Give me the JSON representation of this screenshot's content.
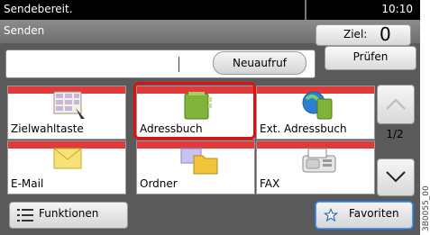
{
  "status": {
    "text": "Sendebereit.",
    "time": "10:10"
  },
  "title": {
    "text": "Senden"
  },
  "destination": {
    "label": "Ziel:",
    "count": "0"
  },
  "actions": {
    "recall": "Neuaufruf",
    "check": "Prüfen"
  },
  "tiles": [
    {
      "label": "Zielwahltaste",
      "icon": "speed-dial-icon"
    },
    {
      "label": "Adressbuch",
      "icon": "address-book-icon",
      "selected": true
    },
    {
      "label": "Ext. Adressbuch",
      "icon": "external-address-book-icon"
    },
    {
      "label": "E-Mail",
      "icon": "email-icon"
    },
    {
      "label": "Ordner",
      "icon": "folder-icon"
    },
    {
      "label": "FAX",
      "icon": "fax-icon"
    }
  ],
  "pager": {
    "page": "1/2"
  },
  "bottom": {
    "functions": "Funktionen",
    "favorites": "Favoriten"
  },
  "side_code": "3B0055_00",
  "colors": {
    "accent_red": "#e23a3a",
    "highlight": "#e01010",
    "favorite_blue": "#2a78e4"
  }
}
